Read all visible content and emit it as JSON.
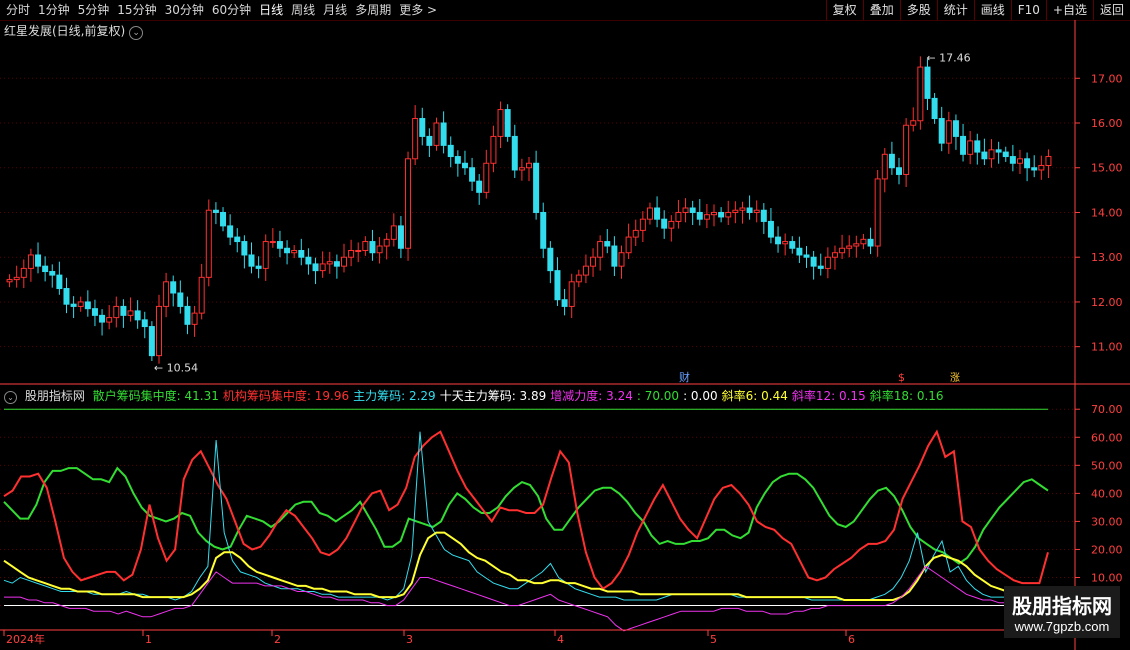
{
  "toolbar": {
    "periods": [
      "分时",
      "1分钟",
      "5分钟",
      "15分钟",
      "30分钟",
      "60分钟",
      "日线",
      "周线",
      "月线",
      "多周期",
      "更多 >"
    ],
    "active_period": "日线",
    "right_buttons": [
      "复权",
      "叠加",
      "多股",
      "统计",
      "画线",
      "F10",
      "+自选",
      "返回"
    ]
  },
  "stock": {
    "title": "红星发展(日线,前复权)",
    "high_label": "17.46",
    "low_label": "10.54"
  },
  "markers": {
    "cai": "财",
    "dollar": "$",
    "tag": "涨"
  },
  "indicator": {
    "name": "股朋指标网",
    "items": [
      {
        "label": "散户筹码集中度: 41.31",
        "color": "#33dd33"
      },
      {
        "label": "机构筹码集中度: 19.96",
        "color": "#ff3030"
      },
      {
        "label": "主力筹码: 2.29",
        "color": "#33ddee"
      },
      {
        "label": "十天主力筹码: 3.89",
        "color": "#ffffff"
      },
      {
        "label": "增减力度: 3.24",
        "color": "#ee33ee"
      },
      {
        "label": ": 70.00",
        "color": "#33dd33"
      },
      {
        "label": ": 0.00",
        "color": "#ffffff"
      },
      {
        "label": "斜率6: 0.44",
        "color": "#ffff33"
      },
      {
        "label": "斜率12: 0.15",
        "color": "#ee33ee"
      },
      {
        "label": "斜率18: 0.16",
        "color": "#33dd33"
      }
    ]
  },
  "date_axis": [
    "2024年",
    "1",
    "2",
    "3",
    "4",
    "5",
    "6"
  ],
  "watermark": {
    "line1": "股朋指标网",
    "line2": "www.7gpzb.com"
  },
  "colors": {
    "up": "#ff3030",
    "down": "#33ddee",
    "grid": "#5a0000",
    "axis": "#ff4040"
  },
  "chart_data": [
    {
      "type": "candlestick",
      "title": "红星发展(日线,前复权)",
      "y_ticks": [
        11.0,
        12.0,
        13.0,
        14.0,
        15.0,
        16.0,
        17.0
      ],
      "ylim": [
        10.3,
        17.9
      ],
      "close": [
        12.5,
        12.55,
        12.75,
        13.05,
        12.8,
        12.68,
        12.6,
        12.3,
        11.95,
        11.9,
        12.0,
        11.85,
        11.7,
        11.55,
        11.65,
        11.9,
        11.7,
        11.8,
        11.6,
        11.45,
        10.8,
        11.9,
        12.45,
        12.2,
        11.9,
        11.5,
        11.75,
        12.55,
        14.05,
        14.0,
        13.7,
        13.45,
        13.35,
        13.05,
        12.8,
        12.75,
        13.35,
        13.35,
        13.2,
        13.1,
        13.15,
        13.0,
        12.85,
        12.7,
        12.85,
        12.9,
        12.8,
        13.0,
        13.15,
        13.15,
        13.35,
        13.1,
        13.25,
        13.4,
        13.7,
        13.2,
        15.2,
        16.1,
        15.7,
        15.5,
        16.0,
        15.5,
        15.25,
        15.1,
        15.0,
        14.7,
        14.45,
        15.1,
        15.7,
        16.3,
        15.7,
        14.95,
        15.0,
        15.1,
        14.0,
        13.2,
        12.7,
        12.05,
        11.9,
        12.45,
        12.6,
        12.8,
        13.0,
        13.35,
        13.25,
        12.8,
        13.1,
        13.45,
        13.6,
        13.85,
        14.1,
        13.85,
        13.65,
        13.8,
        14.0,
        14.1,
        14.0,
        13.85,
        13.95,
        14.0,
        13.9,
        14.0,
        14.05,
        14.1,
        14.0,
        14.05,
        13.8,
        13.45,
        13.3,
        13.35,
        13.2,
        13.05,
        13.0,
        12.8,
        12.75,
        13.0,
        13.1,
        13.2,
        13.25,
        13.3,
        13.4,
        13.25,
        14.75,
        15.3,
        15.0,
        14.85,
        15.95,
        16.05,
        17.25,
        16.55,
        16.1,
        15.55,
        16.05,
        15.7,
        15.3,
        15.6,
        15.35,
        15.2,
        15.4,
        15.35,
        15.25,
        15.1,
        15.2,
        15.0,
        14.95,
        15.05,
        15.25
      ]
    },
    {
      "type": "line",
      "title": "股朋指标网",
      "y_ticks": [
        0,
        10,
        20,
        30,
        40,
        50,
        60,
        70
      ],
      "ylim": [
        -8,
        74
      ],
      "reference_lines": [
        70,
        0
      ],
      "series": [
        {
          "name": "散户筹码集中度",
          "color": "#33dd33",
          "values": [
            37,
            34,
            31,
            31,
            36,
            44,
            48,
            48,
            49,
            49,
            47,
            45,
            45,
            44,
            49,
            46,
            40,
            35,
            32,
            31,
            30,
            31,
            33,
            32,
            26,
            23,
            21,
            20,
            21,
            27,
            32,
            31,
            30,
            28,
            30,
            33,
            36,
            37,
            37,
            33,
            32,
            30,
            32,
            34,
            37,
            32,
            27,
            21,
            21,
            23,
            31,
            30,
            29,
            28,
            30,
            36,
            40,
            38,
            35,
            33,
            33,
            35,
            39,
            42,
            44,
            43,
            39,
            31,
            27,
            27,
            31,
            35,
            38,
            41,
            42,
            42,
            40,
            37,
            33,
            30,
            25,
            22,
            23,
            22,
            22,
            23,
            23,
            24,
            27,
            27,
            25,
            24,
            26,
            35,
            40,
            44,
            46,
            47,
            47,
            45,
            42,
            37,
            32,
            29,
            28,
            30,
            34,
            38,
            41,
            42,
            39,
            34,
            28,
            24,
            22,
            20,
            19,
            17,
            15,
            17,
            21,
            27,
            31,
            35,
            38,
            41,
            44,
            45,
            43,
            41
          ]
        },
        {
          "name": "机构筹码集中度",
          "color": "#ff3030",
          "values": [
            39,
            41,
            46,
            46,
            47,
            42,
            30,
            17,
            12,
            9,
            10,
            11,
            12,
            12,
            9,
            11,
            20,
            36,
            24,
            16,
            20,
            45,
            52,
            55,
            49,
            43,
            38,
            30,
            22,
            20,
            21,
            25,
            30,
            34,
            32,
            28,
            24,
            19,
            18,
            20,
            24,
            30,
            36,
            40,
            41,
            34,
            36,
            42,
            53,
            57,
            60,
            62,
            55,
            48,
            42,
            38,
            34,
            30,
            35,
            34,
            34,
            33,
            33,
            36,
            46,
            55,
            51,
            33,
            19,
            10,
            6,
            8,
            12,
            18,
            26,
            32,
            38,
            43,
            37,
            31,
            27,
            24,
            31,
            38,
            42,
            43,
            40,
            36,
            30,
            28,
            27,
            24,
            22,
            16,
            10,
            9,
            10,
            13,
            15,
            17,
            20,
            22,
            22,
            23,
            27,
            38,
            44,
            50,
            57,
            62,
            53,
            55,
            30,
            28,
            20,
            16,
            13,
            11,
            9,
            8,
            8,
            8,
            19
          ]
        },
        {
          "name": "主力筹码",
          "color": "#33ddee",
          "values": [
            9,
            8,
            10,
            9,
            8,
            7,
            6,
            5,
            5,
            5,
            5,
            4,
            4,
            4,
            4,
            5,
            4,
            4,
            3,
            3,
            3,
            2,
            3,
            5,
            10,
            14,
            59,
            26,
            16,
            12,
            11,
            10,
            8,
            7,
            6,
            6,
            6,
            5,
            5,
            4,
            4,
            3,
            3,
            3,
            3,
            3,
            3,
            2,
            3,
            6,
            18,
            62,
            30,
            25,
            20,
            18,
            17,
            16,
            12,
            10,
            8,
            7,
            6,
            6,
            8,
            10,
            12,
            15,
            10,
            8,
            6,
            5,
            4,
            3,
            3,
            3,
            2,
            2,
            2,
            2,
            2,
            3,
            4,
            4,
            4,
            4,
            4,
            4,
            4,
            4,
            3,
            3,
            3,
            3,
            3,
            3,
            3,
            3,
            3,
            2,
            2,
            2,
            2,
            2,
            2,
            2,
            2,
            3,
            4,
            6,
            10,
            16,
            26,
            12,
            18,
            23,
            12,
            14,
            9,
            6,
            4,
            3,
            3,
            3,
            2,
            2,
            2,
            2,
            2
          ]
        },
        {
          "name": "十天主力筹码",
          "color": "#ffff33",
          "values": [
            16,
            14,
            12,
            10,
            9,
            8,
            7,
            6,
            6,
            5,
            5,
            5,
            4,
            4,
            4,
            4,
            4,
            3,
            3,
            3,
            3,
            3,
            3,
            4,
            6,
            9,
            17,
            19,
            19,
            17,
            14,
            12,
            11,
            10,
            9,
            8,
            7,
            7,
            6,
            6,
            5,
            5,
            5,
            4,
            4,
            4,
            3,
            3,
            3,
            4,
            8,
            18,
            24,
            26,
            26,
            24,
            22,
            19,
            17,
            16,
            14,
            12,
            11,
            9,
            9,
            8,
            8,
            9,
            9,
            8,
            8,
            7,
            6,
            6,
            5,
            5,
            5,
            5,
            4,
            4,
            4,
            4,
            4,
            4,
            4,
            4,
            4,
            4,
            4,
            4,
            4,
            3,
            3,
            3,
            3,
            3,
            3,
            3,
            3,
            3,
            3,
            3,
            3,
            2,
            2,
            2,
            2,
            2,
            2,
            2,
            3,
            5,
            9,
            14,
            17,
            18,
            17,
            16,
            14,
            11,
            9,
            7,
            6,
            5,
            4,
            4,
            4,
            4,
            3
          ]
        },
        {
          "name": "增减力度",
          "color": "#ee33ee",
          "values": [
            3,
            3,
            3,
            2,
            2,
            1,
            1,
            0,
            -1,
            -1,
            -1,
            -2,
            -2,
            -2,
            -3,
            -2,
            -3,
            -4,
            -4,
            -3,
            -2,
            -1,
            -1,
            0,
            4,
            8,
            12,
            10,
            8,
            8,
            8,
            8,
            7,
            7,
            7,
            6,
            5,
            5,
            4,
            3,
            3,
            2,
            2,
            2,
            2,
            1,
            1,
            0,
            0,
            2,
            6,
            10,
            10,
            9,
            8,
            7,
            6,
            5,
            4,
            3,
            2,
            1,
            0,
            0,
            1,
            2,
            3,
            4,
            2,
            1,
            0,
            -1,
            -2,
            -3,
            -4,
            -7,
            -9,
            -8,
            -7,
            -6,
            -5,
            -4,
            -3,
            -2,
            -2,
            -2,
            -2,
            -2,
            -1,
            -1,
            -1,
            -2,
            -2,
            -2,
            -3,
            -3,
            -3,
            -2,
            -2,
            -1,
            -1,
            0,
            0,
            0,
            0,
            0,
            0,
            0,
            0,
            1,
            3,
            6,
            10,
            14,
            12,
            10,
            8,
            6,
            4,
            3,
            2,
            2,
            1,
            1,
            1,
            1,
            1,
            1,
            1
          ]
        },
        {
          "name": "",
          "color": "#ffffff",
          "values": []
        }
      ]
    }
  ]
}
